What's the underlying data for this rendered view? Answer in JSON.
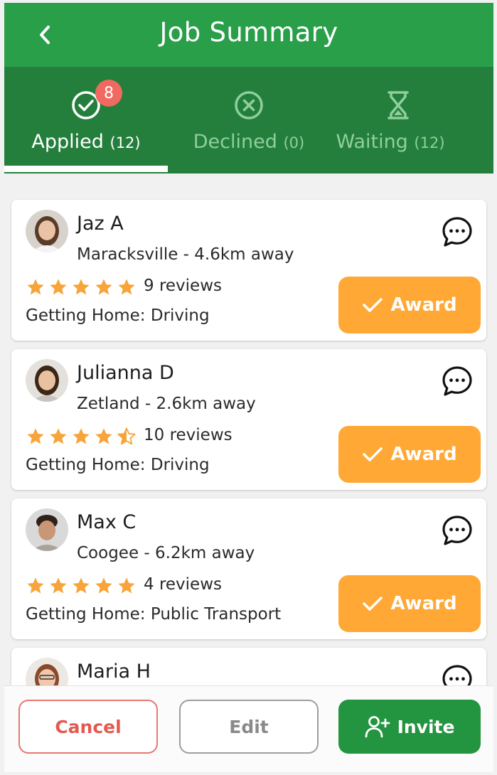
{
  "header": {
    "title": "Job Summary"
  },
  "tabs": [
    {
      "label": "Applied",
      "count": "(12)",
      "badge": "8",
      "icon": "check-circle-icon",
      "active": true
    },
    {
      "label": "Declined",
      "count": "(0)",
      "icon": "x-circle-icon",
      "active": false
    },
    {
      "label": "Waiting",
      "count": "(12)",
      "icon": "hourglass-icon",
      "active": false
    }
  ],
  "applicants": [
    {
      "name": "Jaz A",
      "location": "Maracksville - 4.6km away",
      "rating": 5,
      "reviews": "9 reviews",
      "getting_home": "Getting Home: Driving",
      "award_label": "Award"
    },
    {
      "name": "Julianna D",
      "location": "Zetland - 2.6km away",
      "rating": 4.5,
      "reviews": "10 reviews",
      "getting_home": "Getting Home: Driving",
      "award_label": "Award"
    },
    {
      "name": "Max C",
      "location": "Coogee - 6.2km away",
      "rating": 5,
      "reviews": "4 reviews",
      "getting_home": "Getting Home: Public Transport",
      "award_label": "Award"
    },
    {
      "name": "Maria H"
    }
  ],
  "footer": {
    "cancel_label": "Cancel",
    "edit_label": "Edit",
    "invite_label": "Invite"
  },
  "colors": {
    "primary_green": "#2a9f4a",
    "tab_green": "#247f3c",
    "award_orange": "#ffa835",
    "badge_red": "#f06a61",
    "star": "#f7a53a"
  }
}
